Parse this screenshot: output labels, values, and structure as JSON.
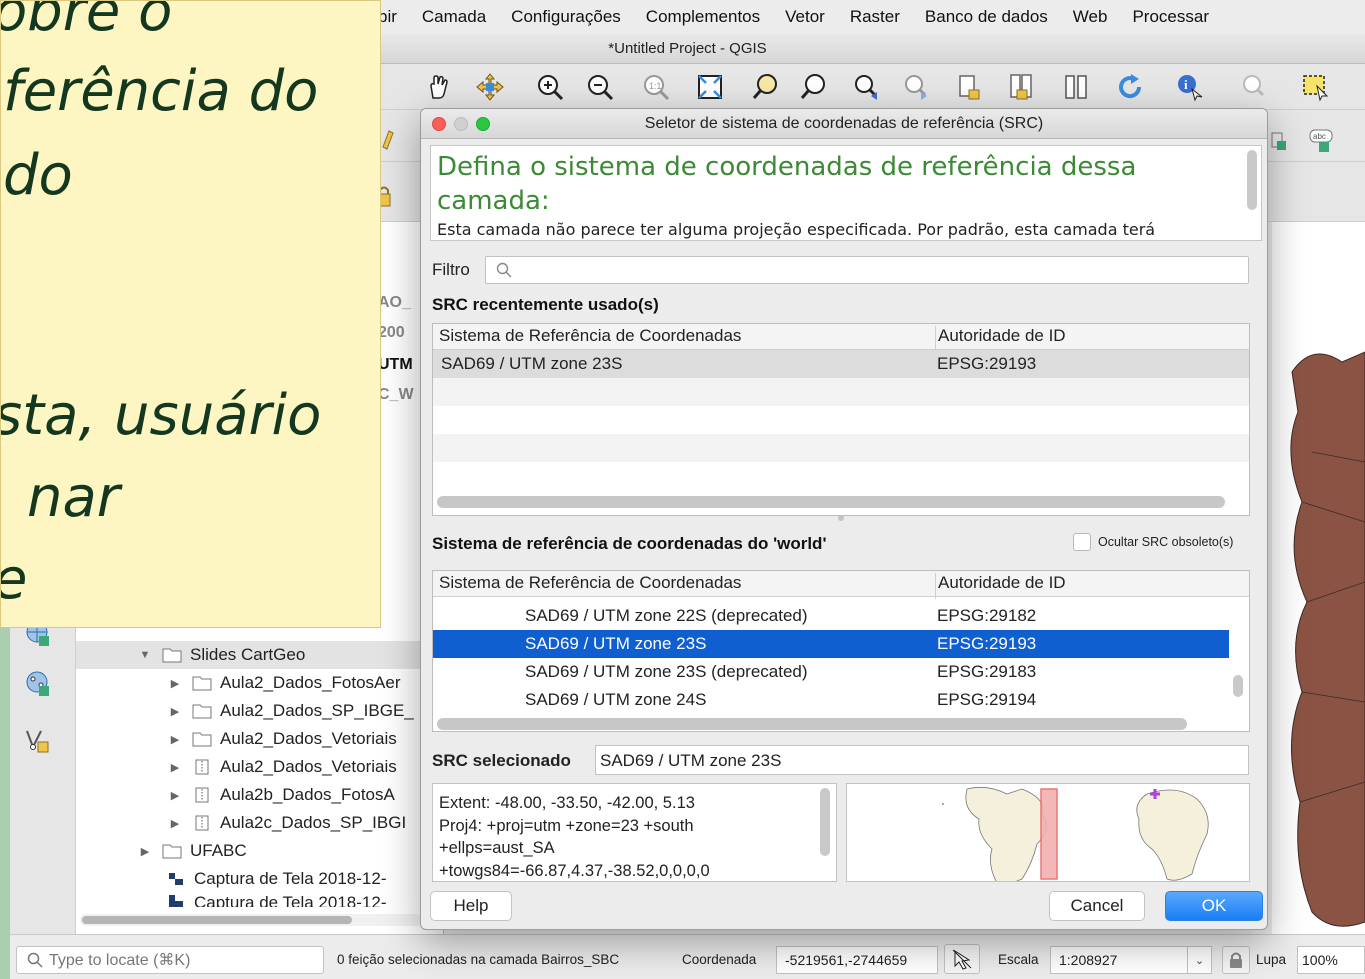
{
  "menubar": {
    "items": [
      "bir",
      "Camada",
      "Configurações",
      "Complementos",
      "Vetor",
      "Raster",
      "Banco de dados",
      "Web",
      "Processar"
    ]
  },
  "window": {
    "title": "*Untitled Project - QGIS"
  },
  "slide": {
    "lines": [
      "obre o",
      "ferência do",
      " do",
      "sta, usuário",
      "nar",
      "e"
    ]
  },
  "browser": {
    "partial_labels": [
      "AO_",
      "200",
      "UTM",
      "C_W"
    ],
    "tree": [
      {
        "label": "Slides CartGeo",
        "indent": 1,
        "expanded": true,
        "icon": "folder"
      },
      {
        "label": "Aula2_Dados_FotosAer",
        "indent": 2,
        "icon": "folder"
      },
      {
        "label": "Aula2_Dados_SP_IBGE_",
        "indent": 2,
        "icon": "folder"
      },
      {
        "label": "Aula2_Dados_Vetoriais",
        "indent": 2,
        "icon": "folder"
      },
      {
        "label": "Aula2_Dados_Vetoriais",
        "indent": 2,
        "icon": "zip"
      },
      {
        "label": "Aula2b_Dados_FotosA",
        "indent": 2,
        "icon": "zip"
      },
      {
        "label": "Aula2c_Dados_SP_IBGI",
        "indent": 2,
        "icon": "zip"
      },
      {
        "label": "UFABC",
        "indent": 1,
        "icon": "folder"
      },
      {
        "label": "Captura de Tela 2018-12-",
        "indent": 1,
        "icon": "image"
      },
      {
        "label": "Captura de Tela 2018-12-",
        "indent": 1,
        "icon": "image"
      }
    ]
  },
  "dialog": {
    "title": "Seletor de sistema de coordenadas de referência (SRC)",
    "header_title": "Defina o sistema de coordenadas de referência dessa camada:",
    "header_message": "Esta camada não parece ter alguma projeção especificada. Por padrão, esta camada terá",
    "filter_label": "Filtro",
    "filter_value": "",
    "recent": {
      "label": "SRC recentemente usado(s)",
      "col1": "Sistema de Referência de Coordenadas",
      "col2": "Autoridade de ID",
      "rows": [
        {
          "name": "SAD69 / UTM zone 23S",
          "id": "EPSG:29193"
        }
      ]
    },
    "world": {
      "label": "Sistema de referência de coordenadas do 'world'",
      "hide_obsolete_label": "Ocultar SRC obsoleto(s)",
      "hide_obsolete_checked": false,
      "col1": "Sistema de Referência de Coordenadas",
      "col2": "Autoridade de ID",
      "rows": [
        {
          "name": "SAD69 / UTM zone 22S (deprecated)",
          "id": "EPSG:29182"
        },
        {
          "name": "SAD69 / UTM zone 23S",
          "id": "EPSG:29193",
          "selected": true
        },
        {
          "name": "SAD69 / UTM zone 23S (deprecated)",
          "id": "EPSG:29183"
        },
        {
          "name": "SAD69 / UTM zone 24S",
          "id": "EPSG:29194"
        }
      ]
    },
    "selected": {
      "label": "SRC selecionado",
      "value": "SAD69 / UTM zone 23S"
    },
    "details": {
      "lines": [
        "Extent: -48.00, -33.50, -42.00, 5.13",
        "Proj4: +proj=utm +zone=23 +south",
        "+ellps=aust_SA",
        "+towgs84=-66.87,4.37,-38.52,0,0,0,0"
      ]
    },
    "buttons": {
      "help": "Help",
      "cancel": "Cancel",
      "ok": "OK"
    }
  },
  "statusbar": {
    "locate_placeholder": "Type to locate (⌘K)",
    "selection_msg": "0 feição selecionadas na camada Bairros_SBC",
    "coord_label": "Coordenada",
    "coord_value": "-5219561,-2744659",
    "scale_label": "Escala",
    "scale_value": "1:208927",
    "zoom_label": "Lupa",
    "zoom_value": "100%"
  },
  "colors": {
    "accent_blue": "#0f5fd0",
    "header_green": "#3c8a36",
    "map_polygon": "#8b5344",
    "slide_background": "#fdf5c2",
    "slide_text": "#13381f"
  }
}
